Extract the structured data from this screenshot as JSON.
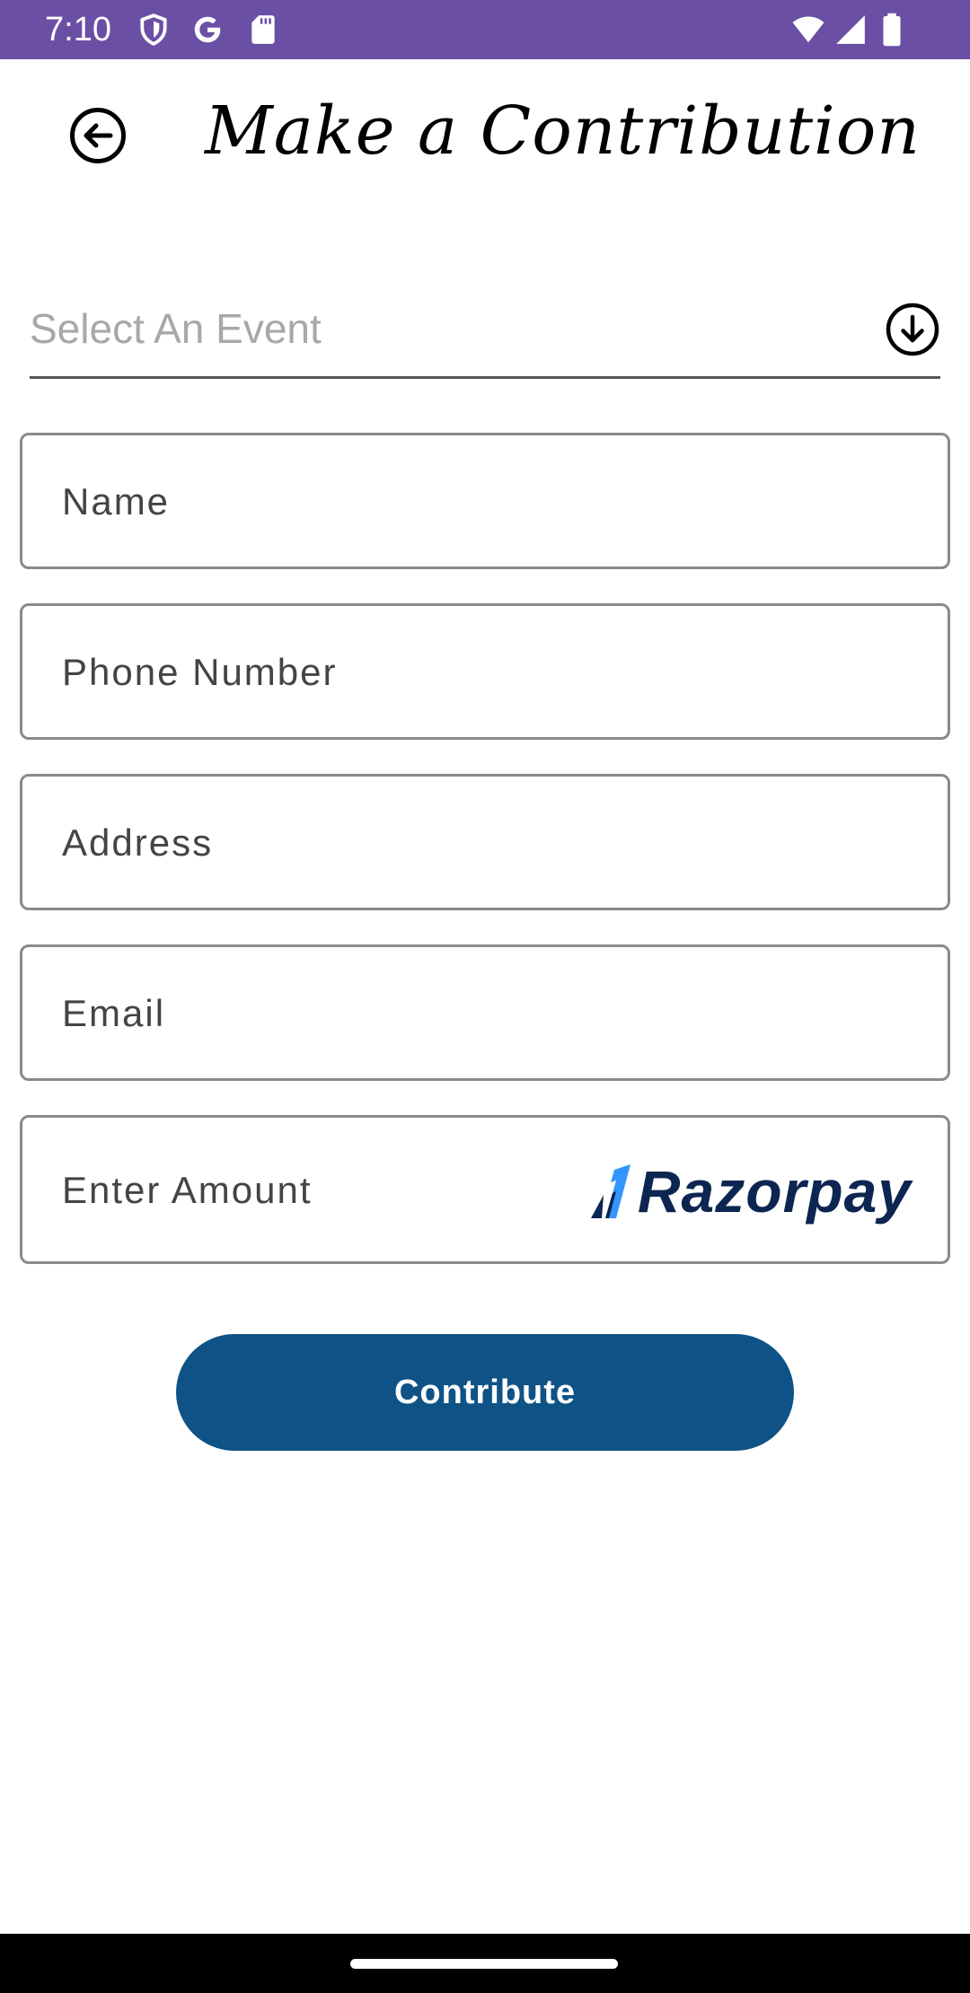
{
  "status_bar": {
    "time": "7:10",
    "background": "#6a4fa4",
    "left_icons": [
      "shield-icon",
      "google-icon",
      "sd-card-icon"
    ],
    "right_icons": [
      "wifi-icon",
      "signal-icon",
      "battery-icon"
    ]
  },
  "header": {
    "title": "Make a Contribution",
    "back_icon": "arrow-left-circle-icon"
  },
  "form": {
    "event_select": {
      "placeholder": "Select An Event",
      "icon": "arrow-down-circle-icon"
    },
    "fields": [
      {
        "label": "Name"
      },
      {
        "label": "Phone Number"
      },
      {
        "label": "Address"
      },
      {
        "label": "Email"
      },
      {
        "label": "Enter Amount"
      }
    ],
    "payment_logo_text": "Razorpay",
    "submit_label": "Contribute"
  },
  "colors": {
    "button": "#0f5386",
    "razorpay_text": "#0c2651",
    "razorpay_accent": "#3395ff",
    "field_border": "#8a8a8a"
  }
}
